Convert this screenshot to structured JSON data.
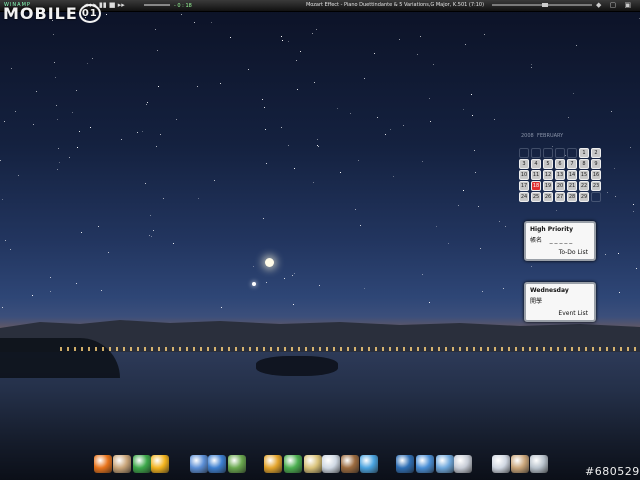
{
  "topbar": {
    "player_name": "WINAMP",
    "controls": "◂◂ ▸ ▮▮ ■ ▸▸",
    "elapsed": "- 0 : 18",
    "track": "Mozart Effect - Piano Duettindante & 5 Variations,G Major, K.501 (7:10)",
    "window_buttons": "◆ ▢ ▣"
  },
  "logo": {
    "text": "MOBILE",
    "number": "01"
  },
  "calendar": {
    "year": "2008",
    "month": "FEBRUARY",
    "days": [
      "",
      "",
      "",
      "",
      "",
      "1",
      "2",
      "3",
      "4",
      "5",
      "6",
      "7",
      "8",
      "9",
      "10",
      "11",
      "12",
      "13",
      "14",
      "15",
      "16",
      "17",
      "18",
      "19",
      "20",
      "21",
      "22",
      "23",
      "24",
      "25",
      "26",
      "27",
      "28",
      "29",
      ""
    ],
    "today": "18"
  },
  "todo_note": {
    "title": "High Priority",
    "body": "帳名    _ _ _ _ _",
    "link": "To-Do List"
  },
  "event_note": {
    "title": "Wednesday",
    "body": "開學",
    "link": "Event List"
  },
  "taskbar_icons": [
    {
      "name": "firefox-icon",
      "color": "#e8741c"
    },
    {
      "name": "tools-icon",
      "color": "#c9a57a"
    },
    {
      "name": "messenger-icon",
      "color": "#3da84a"
    },
    {
      "name": "smiley-icon",
      "color": "#f2b31e"
    },
    {
      "name": "paint-icon",
      "color": "#5c8fd6"
    },
    {
      "name": "settings-gear-icon",
      "color": "#3d7fd0"
    },
    {
      "name": "windows-update-icon",
      "color": "#6aa84f"
    },
    {
      "name": "folder-icon",
      "color": "#e3a42c"
    },
    {
      "name": "refresh-icon",
      "color": "#4caf50"
    },
    {
      "name": "notepad-icon",
      "color": "#d9c27a"
    },
    {
      "name": "write-icon",
      "color": "#cfd8e3"
    },
    {
      "name": "image-viewer-icon",
      "color": "#9c6b3f"
    },
    {
      "name": "run-icon",
      "color": "#4aa3df"
    },
    {
      "name": "monitor-icon",
      "color": "#2f6fb5"
    },
    {
      "name": "pen-tool-icon",
      "color": "#4a8fd6"
    },
    {
      "name": "recycle-bin-icon",
      "color": "#6fa8dc"
    },
    {
      "name": "clock-icon",
      "color": "#c7ccd6"
    },
    {
      "name": "mail-icon",
      "color": "#d0d7e2"
    },
    {
      "name": "brush-icon",
      "color": "#c9a57a"
    },
    {
      "name": "photo-icon",
      "color": "#b8c2cc"
    }
  ],
  "watermark": "#680529"
}
